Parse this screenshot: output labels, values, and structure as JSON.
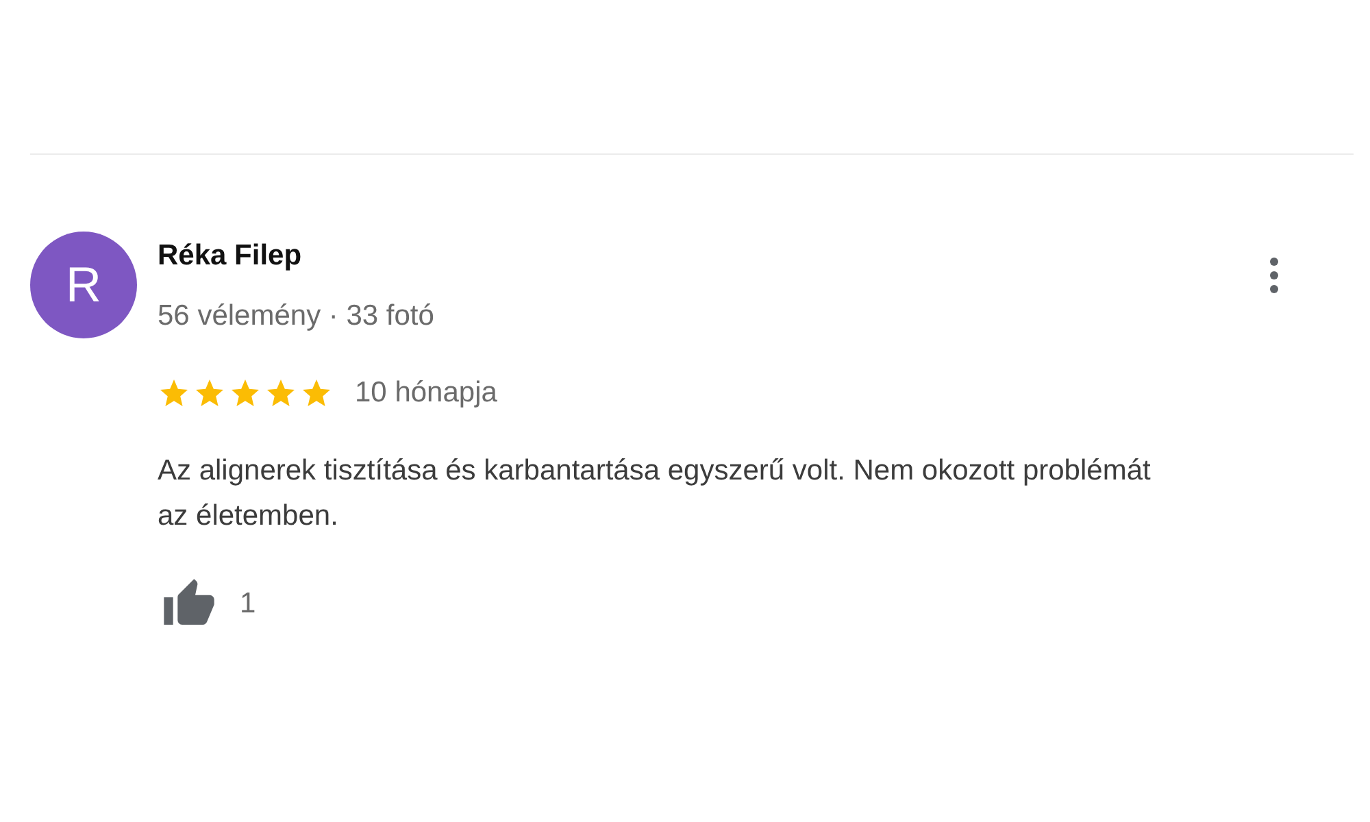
{
  "review": {
    "avatar_initial": "R",
    "author": "Réka Filep",
    "meta": "56 vélemény · 33 fotó",
    "stars": 5,
    "time": "10 hónapja",
    "text": "Az alignerek tisztítása és karbantartása egyszerű volt. Nem okozott problémát az életemben.",
    "likes": "1"
  }
}
